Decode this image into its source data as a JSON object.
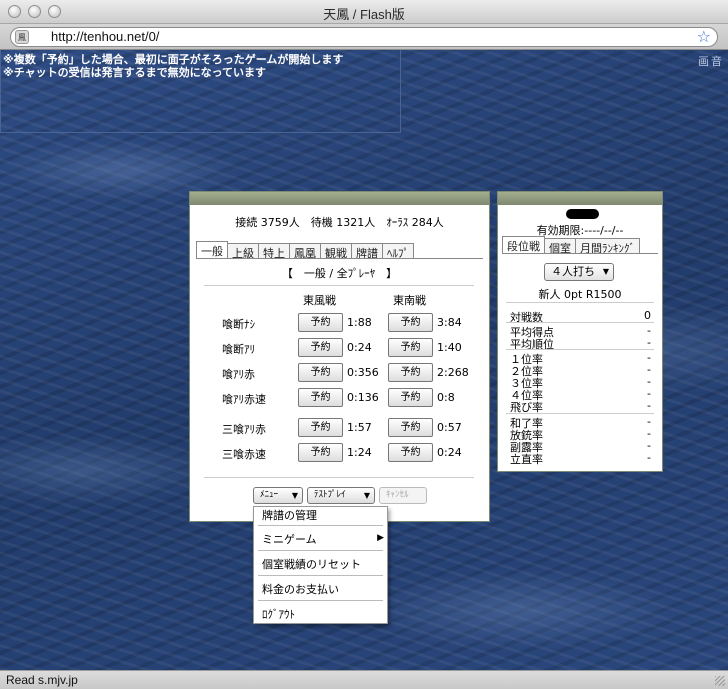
{
  "window": {
    "title": "天鳳 / Flash版",
    "url": "http://tenhou.net/0/",
    "status": "Read s.mjv.jp"
  },
  "notice": {
    "line1": "※複数「予約」した場合、最初に面子がそろったゲームが開始します",
    "line2": "※チャットの受信は発言するまで無効になっています",
    "corner_text": "画音"
  },
  "lobby": {
    "connection": "接続 3759人　待機 1321人　ｵｰﾗｽ 284人",
    "tabs": [
      "一般",
      "上級",
      "特上",
      "鳳凰",
      "観戦",
      "牌譜",
      "ﾍﾙﾌﾟ"
    ],
    "header": "【　一般 / 全ﾌﾟﾚｰﾔ　】",
    "col_east": "東風戦",
    "col_south": "東南戦",
    "reserve_label": "予約",
    "rows": [
      {
        "label": "喰断ﾅｼ",
        "east": "1:88",
        "south": "3:84"
      },
      {
        "label": "喰断ｱﾘ",
        "east": "0:24",
        "south": "1:40"
      },
      {
        "label": "喰ｱﾘ赤",
        "east": "0:356",
        "south": "2:268"
      },
      {
        "label": "喰ｱﾘ赤速",
        "east": "0:136",
        "south": "0:8"
      },
      {
        "label": "三喰ｱﾘ赤",
        "east": "1:57",
        "south": "0:57"
      },
      {
        "label": "三喰赤速",
        "east": "1:24",
        "south": "0:24"
      }
    ],
    "menu_button": "ﾒﾆｭｰ",
    "testplay_button": "ﾃｽﾄﾌﾟﾚｲ",
    "cancel_button": "ｷｬﾝｾﾙ"
  },
  "menu": {
    "items": [
      "牌譜の管理",
      "ミニゲーム",
      "個室戦績のリセット",
      "料金のお支払い",
      "ﾛｸﾞｱｳﾄ"
    ]
  },
  "profile": {
    "expiry": "有効期限:----/--/--",
    "tabs": [
      "段位戦",
      "個室",
      "月間ﾗﾝｷﾝｸﾞ"
    ],
    "mode_select": "４人打ち",
    "rank": "新人 0pt R1500",
    "stats": [
      {
        "label": "対戦数",
        "value": "0"
      },
      {
        "label": "平均得点",
        "value": "-"
      },
      {
        "label": "平均順位",
        "value": "-"
      },
      {
        "label": "１位率",
        "value": "-"
      },
      {
        "label": "２位率",
        "value": "-"
      },
      {
        "label": "３位率",
        "value": "-"
      },
      {
        "label": "４位率",
        "value": "-"
      },
      {
        "label": "飛び率",
        "value": "-"
      },
      {
        "label": "和了率",
        "value": "-"
      },
      {
        "label": "放銃率",
        "value": "-"
      },
      {
        "label": "副露率",
        "value": "-"
      },
      {
        "label": "立直率",
        "value": "-"
      }
    ]
  },
  "colors": {
    "background": "#2a4678",
    "panel_bar": "#8a957a",
    "url_star": "#3a6fd8"
  }
}
